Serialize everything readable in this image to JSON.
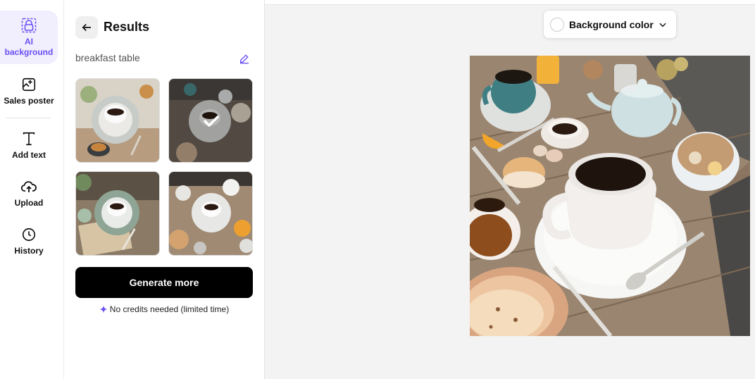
{
  "rail": {
    "items": [
      {
        "label": "AI background",
        "icon": "ai-background-icon",
        "active": true
      },
      {
        "label": "Sales poster",
        "icon": "sales-poster-icon"
      },
      {
        "label": "Add text",
        "icon": "text-icon"
      },
      {
        "label": "Upload",
        "icon": "upload-cloud-icon"
      },
      {
        "label": "History",
        "icon": "clock-icon"
      }
    ]
  },
  "panel": {
    "title": "Results",
    "prompt": "breakfast table",
    "selected_result": 2,
    "generate_label": "Generate more",
    "credits_note": "No credits needed (limited time)"
  },
  "canvas": {
    "background_select_label": "Background color"
  },
  "colors": {
    "accent": "#6a4ef5",
    "primary_button": "#000000",
    "canvas_bg": "#f3f3f3"
  }
}
